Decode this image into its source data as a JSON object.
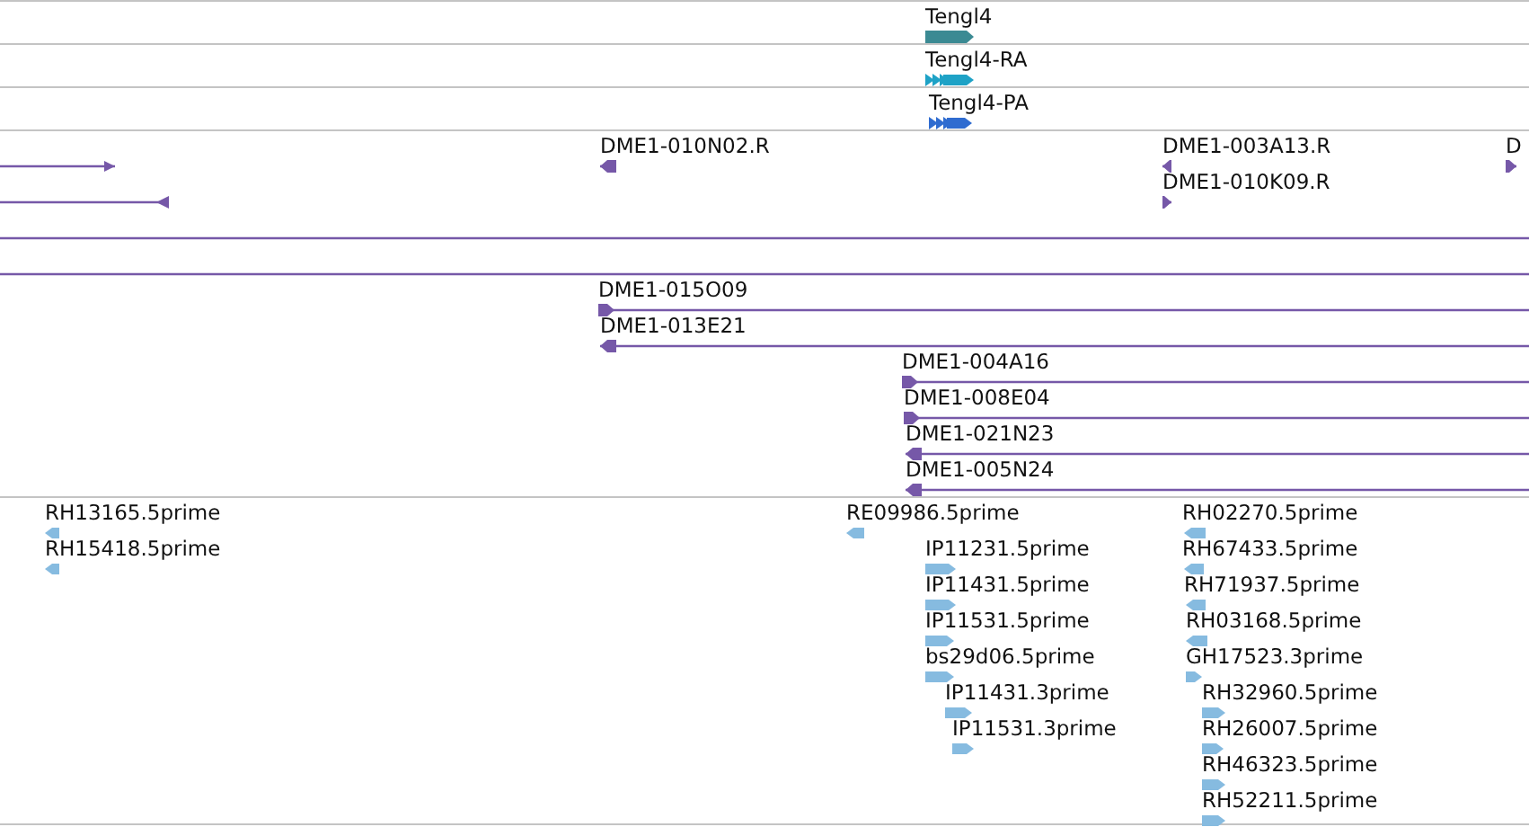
{
  "tracks": [
    {
      "kind": "gene",
      "features": [
        {
          "label": "Tengl4",
          "reverse": false
        }
      ]
    },
    {
      "kind": "mrna",
      "features": [
        {
          "label": "Tengl4-RA",
          "reverse": false
        }
      ]
    },
    {
      "kind": "protein",
      "features": [
        {
          "label": "Tengl4-PA",
          "reverse": false
        }
      ]
    },
    {
      "kind": "clone",
      "features": [
        {
          "kind": "arrow",
          "reverse": false
        },
        {
          "kind": "arrow",
          "reverse": true
        },
        {
          "kind": "arrow",
          "label": "DME1-010N02.R",
          "reverse": true
        },
        {
          "kind": "arrow",
          "label": "DME1-003A13.R",
          "reverse": true
        },
        {
          "kind": "arrow",
          "label": "DME1-010K09.R",
          "reverse": false
        },
        {
          "kind": "arrow",
          "label": "D",
          "reverse": false
        },
        {
          "kind": "line"
        },
        {
          "kind": "line"
        },
        {
          "kind": "arrow",
          "label": "DME1-015O09",
          "reverse": false
        },
        {
          "kind": "arrow",
          "label": "DME1-013E21",
          "reverse": true
        },
        {
          "kind": "arrow",
          "label": "DME1-004A16",
          "reverse": false
        },
        {
          "kind": "arrow",
          "label": "DME1-008E04",
          "reverse": false
        },
        {
          "kind": "arrow",
          "label": "DME1-021N23",
          "reverse": true
        },
        {
          "kind": "arrow",
          "label": "DME1-005N24",
          "reverse": true
        }
      ]
    },
    {
      "kind": "est",
      "features": [
        {
          "label": "RH13165.5prime",
          "reverse": true
        },
        {
          "label": "RH15418.5prime",
          "reverse": true
        },
        {
          "label": "RE09986.5prime",
          "reverse": true
        },
        {
          "label": "IP11231.5prime",
          "reverse": false
        },
        {
          "label": "IP11431.5prime",
          "reverse": false
        },
        {
          "label": "IP11531.5prime",
          "reverse": false
        },
        {
          "label": "bs29d06.5prime",
          "reverse": false
        },
        {
          "label": "IP11431.3prime",
          "reverse": false
        },
        {
          "label": "IP11531.3prime",
          "reverse": false
        },
        {
          "label": "RH02270.5prime",
          "reverse": true
        },
        {
          "label": "RH67433.5prime",
          "reverse": true
        },
        {
          "label": "RH71937.5prime",
          "reverse": true
        },
        {
          "label": "RH03168.5prime",
          "reverse": true
        },
        {
          "label": "GH17523.3prime",
          "reverse": false
        },
        {
          "label": "RH32960.5prime",
          "reverse": false
        },
        {
          "label": "RH26007.5prime",
          "reverse": false
        },
        {
          "label": "RH46323.5prime",
          "reverse": false
        },
        {
          "label": "RH52211.5prime",
          "reverse": false
        }
      ]
    }
  ]
}
